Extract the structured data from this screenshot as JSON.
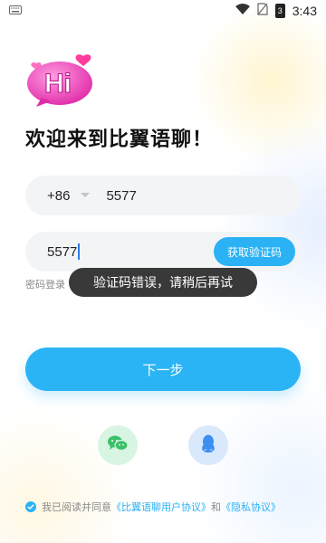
{
  "status_bar": {
    "time": "3:43",
    "battery_level": "3"
  },
  "logo": {
    "text": "Hi"
  },
  "title": "欢迎来到比翼语聊！",
  "phone": {
    "country_code": "+86",
    "value": "5577"
  },
  "code": {
    "value": "5577",
    "get_code_label": "获取验证码"
  },
  "password_login_label": "密码登录",
  "toast_message": "验证码错误，请稍后再试",
  "next_label": "下一步",
  "agreement": {
    "prefix": "我已阅读并同意",
    "user_agreement": "《比翼语聊用户协议》",
    "and": "和",
    "privacy": "《隐私协议》"
  },
  "colors": {
    "accent": "#2ab2f5",
    "wechat": "#3cc06a",
    "qq": "#3d8ff0"
  }
}
